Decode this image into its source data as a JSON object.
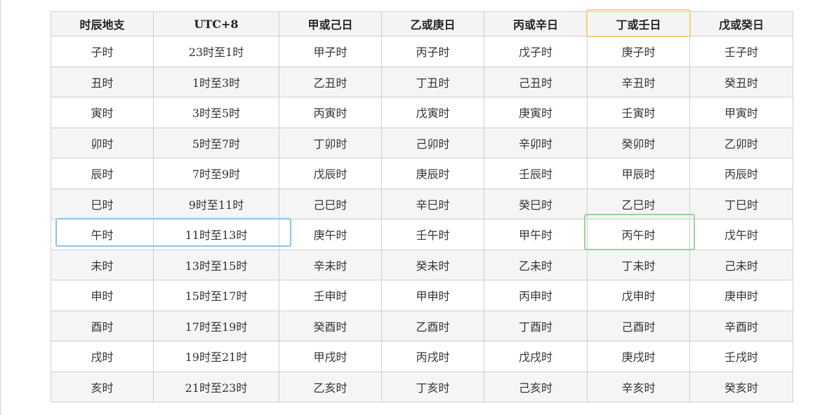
{
  "table": {
    "headers": [
      "时辰地支",
      "UTC+8",
      "甲或己日",
      "乙或庚日",
      "丙或辛日",
      "丁或壬日",
      "戊或癸日"
    ],
    "rows": [
      [
        "子时",
        "23时至1时",
        "甲子时",
        "丙子时",
        "戊子时",
        "庚子时",
        "壬子时"
      ],
      [
        "丑时",
        "1时至3时",
        "乙丑时",
        "丁丑时",
        "己丑时",
        "辛丑时",
        "癸丑时"
      ],
      [
        "寅时",
        "3时至5时",
        "丙寅时",
        "戊寅时",
        "庚寅时",
        "壬寅时",
        "甲寅时"
      ],
      [
        "卯时",
        "5时至7时",
        "丁卯时",
        "己卯时",
        "辛卯时",
        "癸卯时",
        "乙卯时"
      ],
      [
        "辰时",
        "7时至9时",
        "戊辰时",
        "庚辰时",
        "壬辰时",
        "甲辰时",
        "丙辰时"
      ],
      [
        "巳时",
        "9时至11时",
        "己巳时",
        "辛巳时",
        "癸巳时",
        "乙巳时",
        "丁巳时"
      ],
      [
        "午时",
        "11时至13时",
        "庚午时",
        "壬午时",
        "甲午时",
        "丙午时",
        "戊午时"
      ],
      [
        "未时",
        "13时至15时",
        "辛未时",
        "癸未时",
        "乙未时",
        "丁未时",
        "己未时"
      ],
      [
        "申时",
        "15时至17时",
        "壬申时",
        "甲申时",
        "丙申时",
        "戊申时",
        "庚申时"
      ],
      [
        "酉时",
        "17时至19时",
        "癸酉时",
        "乙酉时",
        "丁酉时",
        "己酉时",
        "辛酉时"
      ],
      [
        "戌时",
        "19时至21时",
        "甲戌时",
        "丙戌时",
        "戊戌时",
        "庚戌时",
        "壬戌时"
      ],
      [
        "亥时",
        "21时至23时",
        "乙亥时",
        "丁亥时",
        "己亥时",
        "辛亥时",
        "癸亥时"
      ]
    ]
  },
  "colors": {
    "highlight_header": "#f5d27a",
    "highlight_row": "#8cc3ec",
    "highlight_cell": "#97d49a",
    "grid_border": "#cfcfcf",
    "header_bg": "#f4f4f4",
    "alt_row_bg": "#f5f5f5"
  }
}
